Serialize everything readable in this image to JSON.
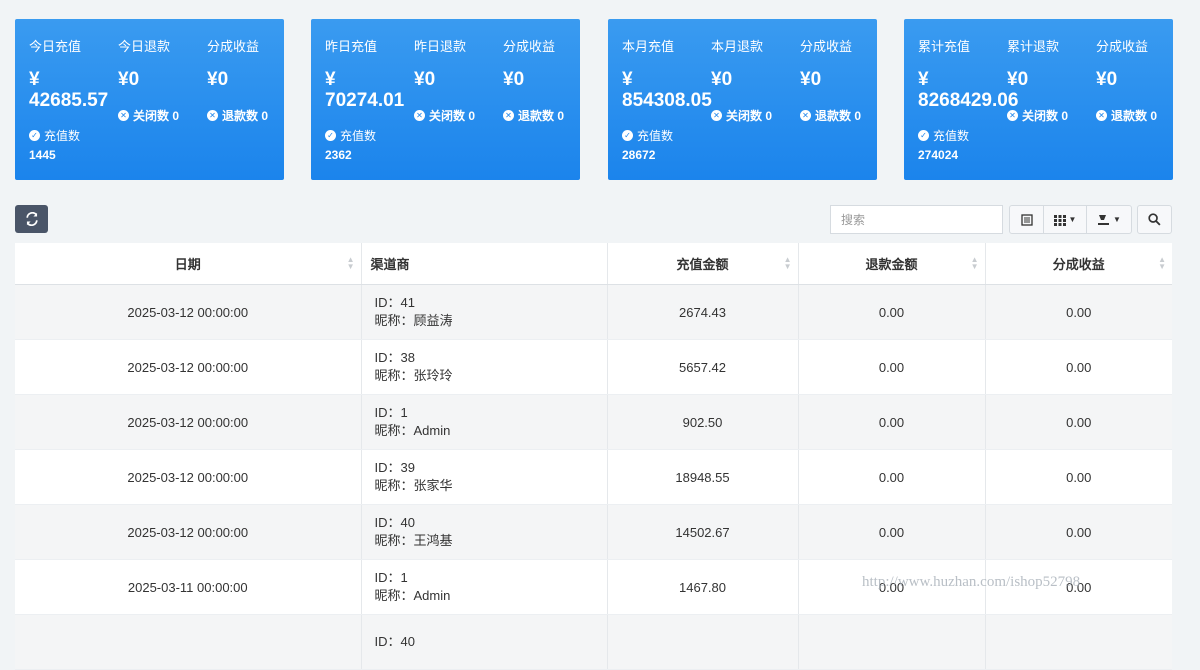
{
  "cards": [
    {
      "labels": [
        "今日充值",
        "今日退款",
        "分成收益"
      ],
      "recharge_currency": "¥",
      "recharge_value": "42685.57",
      "refund_value": "¥0",
      "share_value": "¥0",
      "closed_label": "关闭数 0",
      "refund_count_label": "退款数 0",
      "recharge_count_label": "充值数",
      "recharge_count": "1445"
    },
    {
      "labels": [
        "昨日充值",
        "昨日退款",
        "分成收益"
      ],
      "recharge_currency": "¥",
      "recharge_value": "70274.01",
      "refund_value": "¥0",
      "share_value": "¥0",
      "closed_label": "关闭数 0",
      "refund_count_label": "退款数 0",
      "recharge_count_label": "充值数",
      "recharge_count": "2362"
    },
    {
      "labels": [
        "本月充值",
        "本月退款",
        "分成收益"
      ],
      "recharge_currency": "¥",
      "recharge_value": "854308.05",
      "refund_value": "¥0",
      "share_value": "¥0",
      "closed_label": "关闭数 0",
      "refund_count_label": "退款数 0",
      "recharge_count_label": "充值数",
      "recharge_count": "28672"
    },
    {
      "labels": [
        "累计充值",
        "累计退款",
        "分成收益"
      ],
      "recharge_currency": "¥",
      "recharge_value": "8268429.06",
      "refund_value": "¥0",
      "share_value": "¥0",
      "closed_label": "关闭数 0",
      "refund_count_label": "退款数 0",
      "recharge_count_label": "充值数",
      "recharge_count": "274024"
    }
  ],
  "toolbar": {
    "refresh_icon": "refresh-icon",
    "search_placeholder": "搜索",
    "view_icons": [
      "list-icon",
      "columns-icon",
      "export-icon"
    ],
    "search_icon": "search-icon"
  },
  "table": {
    "headers": [
      "日期",
      "渠道商",
      "充值金额",
      "退款金额",
      "分成收益"
    ],
    "rows": [
      {
        "date": "2025-03-12 00:00:00",
        "id": "ID：41",
        "nick": "昵称：顾益涛",
        "recharge": "2674.43",
        "refund": "0.00",
        "share": "0.00"
      },
      {
        "date": "2025-03-12 00:00:00",
        "id": "ID：38",
        "nick": "昵称：张玲玲",
        "recharge": "5657.42",
        "refund": "0.00",
        "share": "0.00"
      },
      {
        "date": "2025-03-12 00:00:00",
        "id": "ID：1",
        "nick": "昵称：Admin",
        "recharge": "902.50",
        "refund": "0.00",
        "share": "0.00"
      },
      {
        "date": "2025-03-12 00:00:00",
        "id": "ID：39",
        "nick": "昵称：张家华",
        "recharge": "18948.55",
        "refund": "0.00",
        "share": "0.00"
      },
      {
        "date": "2025-03-12 00:00:00",
        "id": "ID：40",
        "nick": "昵称：王鸿基",
        "recharge": "14502.67",
        "refund": "0.00",
        "share": "0.00"
      },
      {
        "date": "2025-03-11 00:00:00",
        "id": "ID：1",
        "nick": "昵称：Admin",
        "recharge": "1467.80",
        "refund": "0.00",
        "share": "0.00"
      },
      {
        "date": "",
        "id": "ID：40",
        "nick": "",
        "recharge": "",
        "refund": "",
        "share": ""
      }
    ]
  },
  "watermark": "http://www.huzhan.com/ishop52798"
}
